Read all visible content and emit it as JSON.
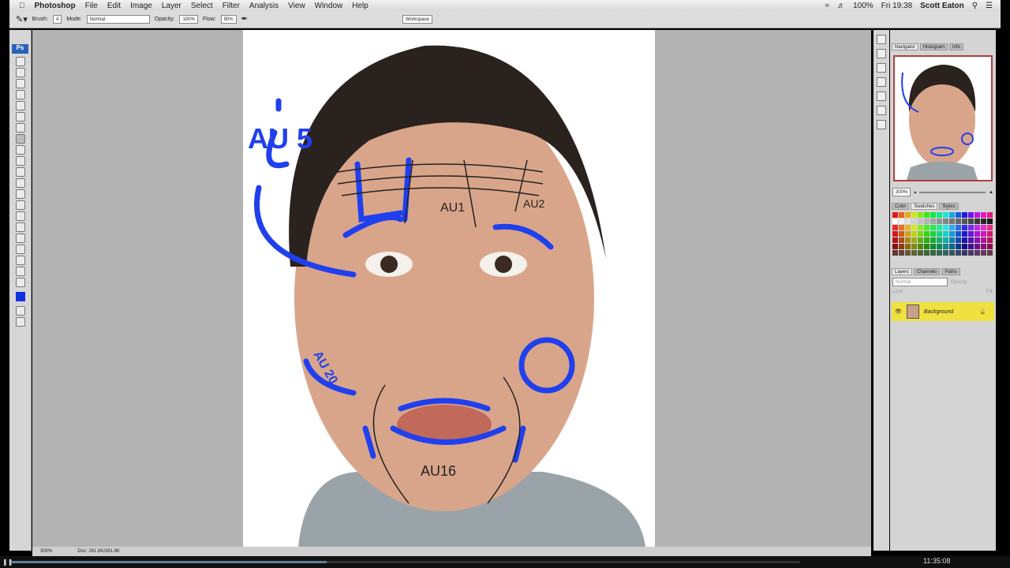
{
  "menubar": {
    "app": "Photoshop",
    "items": [
      "File",
      "Edit",
      "Image",
      "Layer",
      "Select",
      "Filter",
      "Analysis",
      "View",
      "Window",
      "Help"
    ],
    "battery": "100%",
    "clock": "Fri 19:38",
    "user": "Scott Eaton"
  },
  "options": {
    "brush_label": "Brush:",
    "brush_size": "4",
    "mode_label": "Mode:",
    "mode_value": "Normal",
    "opacity_label": "Opacity:",
    "opacity_value": "100%",
    "flow_label": "Flow:",
    "flow_value": "90%",
    "workspace": "Workspace"
  },
  "tools": {
    "logo": "Ps",
    "foreground_color": "#1030e0"
  },
  "document": {
    "annotations": [
      "AU 5",
      "AU1",
      "AU2",
      "AU 20",
      "AU16"
    ]
  },
  "status": {
    "zoom": "300%",
    "doc": "Doc: 261.8K/261.8K"
  },
  "navigator": {
    "tabs": [
      "Navigator",
      "Histogram",
      "Info"
    ],
    "zoom": "300%"
  },
  "swatches_panel": {
    "tabs": [
      "Color",
      "Swatches",
      "Styles"
    ]
  },
  "layers": {
    "tabs": [
      "Layers",
      "Channels",
      "Paths"
    ],
    "blend": "Normal",
    "opacity_label": "Opacity:",
    "lock_label": "Lock:",
    "fill_label": "Fill:",
    "layer_name": "Background"
  },
  "player": {
    "progress": 0.4,
    "time": "11:35:08"
  }
}
